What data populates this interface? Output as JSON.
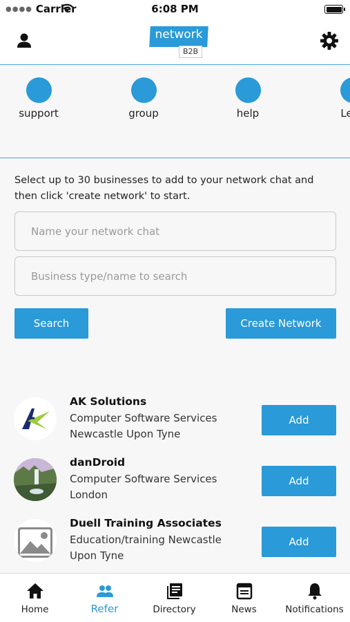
{
  "status_bar": {
    "carrier": "Carrier",
    "time": "6:08 PM"
  },
  "header": {
    "logo_text": "network",
    "logo_sub": "B2B",
    "profile_icon": "person-icon",
    "settings_icon": "gear-icon"
  },
  "categories": [
    {
      "label": "support"
    },
    {
      "label": "group"
    },
    {
      "label": "help"
    },
    {
      "label": "Let's"
    }
  ],
  "instructions": "Select up to 30 businesses to add to your network chat and then click 'create network' to start.",
  "form": {
    "network_name_placeholder": "Name your network chat",
    "search_placeholder": "Business type/name to search",
    "search_label": "Search",
    "create_label": "Create Network"
  },
  "businesses": [
    {
      "name": "AK Solutions",
      "desc": "Computer Software Services Newcastle Upon Tyne",
      "add_label": "Add"
    },
    {
      "name": "danDroid",
      "desc": "Computer Software Services London",
      "add_label": "Add"
    },
    {
      "name": "Duell Training Associates",
      "desc": "Education/training Newcastle Upon Tyne",
      "add_label": "Add"
    }
  ],
  "tabs": [
    {
      "label": "Home",
      "icon": "home-icon"
    },
    {
      "label": "Refer",
      "icon": "people-icon",
      "active": true
    },
    {
      "label": "Directory",
      "icon": "directory-icon"
    },
    {
      "label": "News",
      "icon": "news-icon"
    },
    {
      "label": "Notifications",
      "icon": "bell-icon"
    }
  ],
  "colors": {
    "accent": "#2a9ad8",
    "divider": "#4aa3df"
  }
}
